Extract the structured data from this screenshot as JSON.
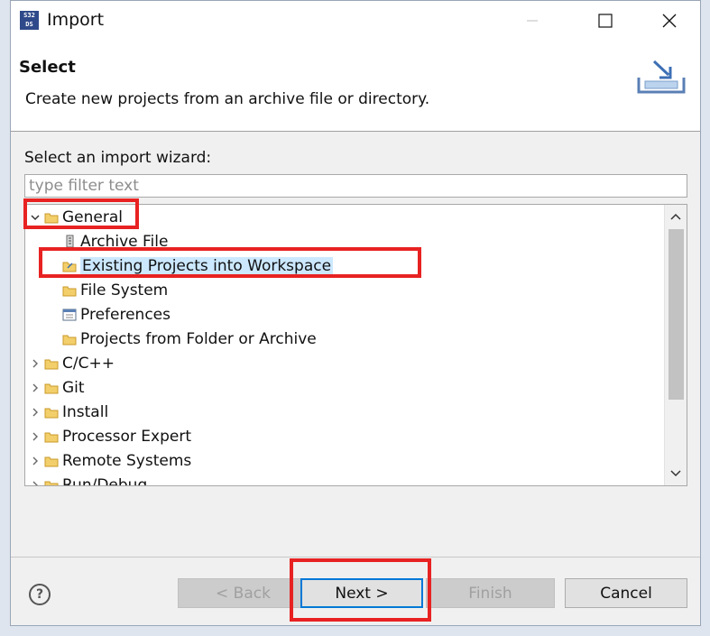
{
  "window": {
    "title": "Import",
    "app_icon_text": "S32 DS",
    "controls": {
      "minimize_icon": "minimize-icon",
      "maximize_icon": "maximize-icon",
      "close_icon": "close-icon"
    }
  },
  "header": {
    "title": "Select",
    "description": "Create new projects from an archive file or directory.",
    "image_icon": "import-wizard-icon"
  },
  "wizard": {
    "label": "Select an import wizard:",
    "filter_placeholder": "type filter text",
    "filter_value": ""
  },
  "tree": {
    "items": [
      {
        "label": "General",
        "expanded": true,
        "icon": "folder-icon"
      },
      {
        "label": "Archive File",
        "icon": "archive-file-icon"
      },
      {
        "label": "Existing Projects into Workspace",
        "icon": "existing-projects-icon",
        "selected": true
      },
      {
        "label": "File System",
        "icon": "folder-icon"
      },
      {
        "label": "Preferences",
        "icon": "preferences-icon"
      },
      {
        "label": "Projects from Folder or Archive",
        "icon": "folder-icon"
      },
      {
        "label": "C/C++",
        "expanded": false,
        "icon": "folder-icon"
      },
      {
        "label": "Git",
        "expanded": false,
        "icon": "folder-icon"
      },
      {
        "label": "Install",
        "expanded": false,
        "icon": "folder-icon"
      },
      {
        "label": "Processor Expert",
        "expanded": false,
        "icon": "folder-icon"
      },
      {
        "label": "Remote Systems",
        "expanded": false,
        "icon": "folder-icon"
      },
      {
        "label": "Run/Debug",
        "expanded": false,
        "icon": "folder-icon"
      }
    ]
  },
  "buttons": {
    "back": "< Back",
    "next": "Next >",
    "finish": "Finish",
    "cancel": "Cancel",
    "help_icon": "help-icon"
  },
  "colors": {
    "highlight_box": "#e82222",
    "selection": "#cce8ff",
    "primary_border": "#0078d7"
  }
}
